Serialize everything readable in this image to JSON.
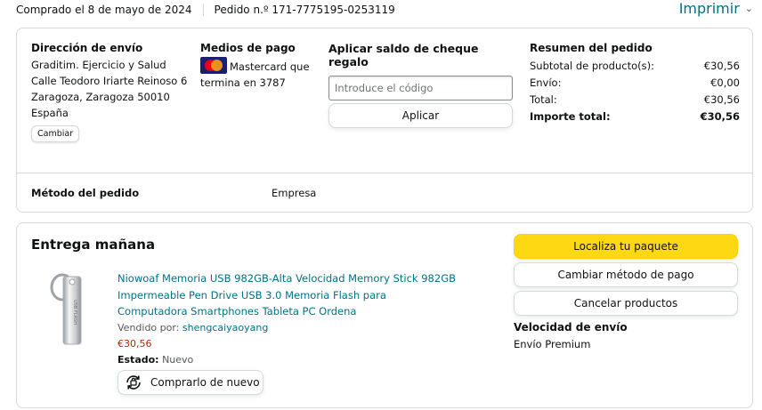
{
  "header": {
    "purchase_date": "Comprado el 8 de mayo de 2024",
    "order_number": "Pedido n.º 171-7775195-0253119",
    "print_label": "Imprimir"
  },
  "shipping": {
    "title": "Dirección de envío",
    "lines": [
      "Graditim. Ejercicio y Salud",
      "Calle Teodoro Iriarte Reinoso 6",
      "Zaragoza, Zaragoza 50010",
      "España"
    ],
    "change_label": "Cambiar"
  },
  "payment": {
    "title": "Medios de pago",
    "card_text": "Mastercard que termina en 3787",
    "card_icon": "mastercard-logo"
  },
  "gift_card": {
    "title": "Aplicar saldo de cheque regalo",
    "placeholder": "Introduce el código",
    "apply_label": "Aplicar"
  },
  "summary": {
    "title": "Resumen del pedido",
    "rows": [
      {
        "label": "Subtotal de producto(s):",
        "value": "€30,56"
      },
      {
        "label": "Envío:",
        "value": "€0,00"
      },
      {
        "label": "Total:",
        "value": "€30,56"
      },
      {
        "label": "Importe total:",
        "value": "€30,56"
      }
    ]
  },
  "order_method": {
    "label": "Método del pedido",
    "value": "Empresa"
  },
  "delivery": {
    "title": "Entrega mañana",
    "item": {
      "title": "Niowoaf Memoria USB 982GB-Alta Velocidad Memory Stick 982GB Impermeable Pen Drive USB 3.0 Memoria Flash para Computadora Smartphones Tableta PC Ordena",
      "seller_prefix": "Vendido por:",
      "seller": "shengcaiyaoyang",
      "price": "€30,56",
      "status_label": "Estado:",
      "status_value": "Nuevo",
      "thumb_text": "USB FLASH"
    },
    "rebuy_label": "Comprarlo de nuevo",
    "track_label": "Localiza tu paquete",
    "change_payment_label": "Cambiar método de pago",
    "cancel_label": "Cancelar productos",
    "speed_title": "Velocidad de envío",
    "speed_value": "Envío Premium"
  },
  "colors": {
    "link": "#007185",
    "price": "#b12704",
    "accent_button": "#ffd814",
    "border": "#d5d9d9"
  }
}
